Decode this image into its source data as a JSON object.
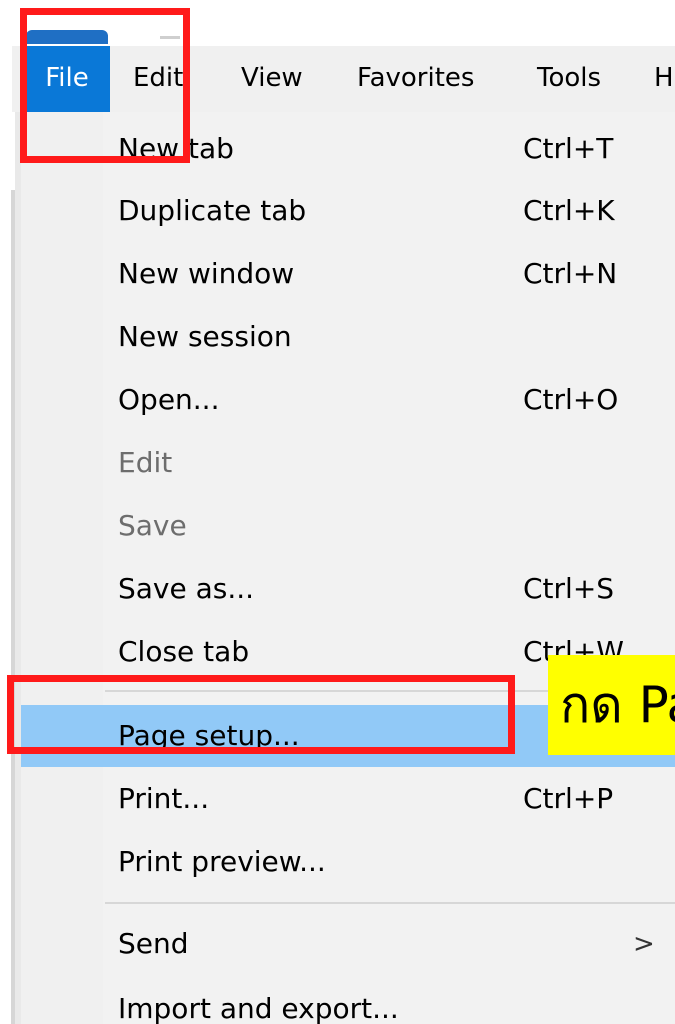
{
  "menubar": {
    "items": [
      {
        "label": "File"
      },
      {
        "label": "Edit"
      },
      {
        "label": "View"
      },
      {
        "label": "Favorites"
      },
      {
        "label": "Tools"
      },
      {
        "label": "H"
      }
    ]
  },
  "file_menu": {
    "items": [
      {
        "label": "New tab",
        "shortcut": "Ctrl+T"
      },
      {
        "label": "Duplicate tab",
        "shortcut": "Ctrl+K"
      },
      {
        "label": "New window",
        "shortcut": "Ctrl+N"
      },
      {
        "label": "New session",
        "shortcut": ""
      },
      {
        "label": "Open...",
        "shortcut": "Ctrl+O"
      },
      {
        "label": "Edit",
        "shortcut": "",
        "disabled": true
      },
      {
        "label": "Save",
        "shortcut": "",
        "disabled": true
      },
      {
        "label": "Save as...",
        "shortcut": "Ctrl+S"
      },
      {
        "label": "Close tab",
        "shortcut": "Ctrl+W"
      },
      {
        "label": "Page setup...",
        "shortcut": "",
        "highlighted": true
      },
      {
        "label": "Print...",
        "shortcut": "Ctrl+P"
      },
      {
        "label": "Print preview...",
        "shortcut": ""
      },
      {
        "label": "Send",
        "shortcut": "",
        "submenu": ">"
      },
      {
        "label": "Import and export...",
        "shortcut": ""
      }
    ]
  },
  "annotation": {
    "note_text": "กด Pa",
    "highlight_color": "#ffff00",
    "box_color": "#ff1a1a"
  },
  "colors": {
    "menubar_active": "#0a78d7",
    "menu_hover": "#91c9f7",
    "menu_bg": "#f2f2f2"
  }
}
